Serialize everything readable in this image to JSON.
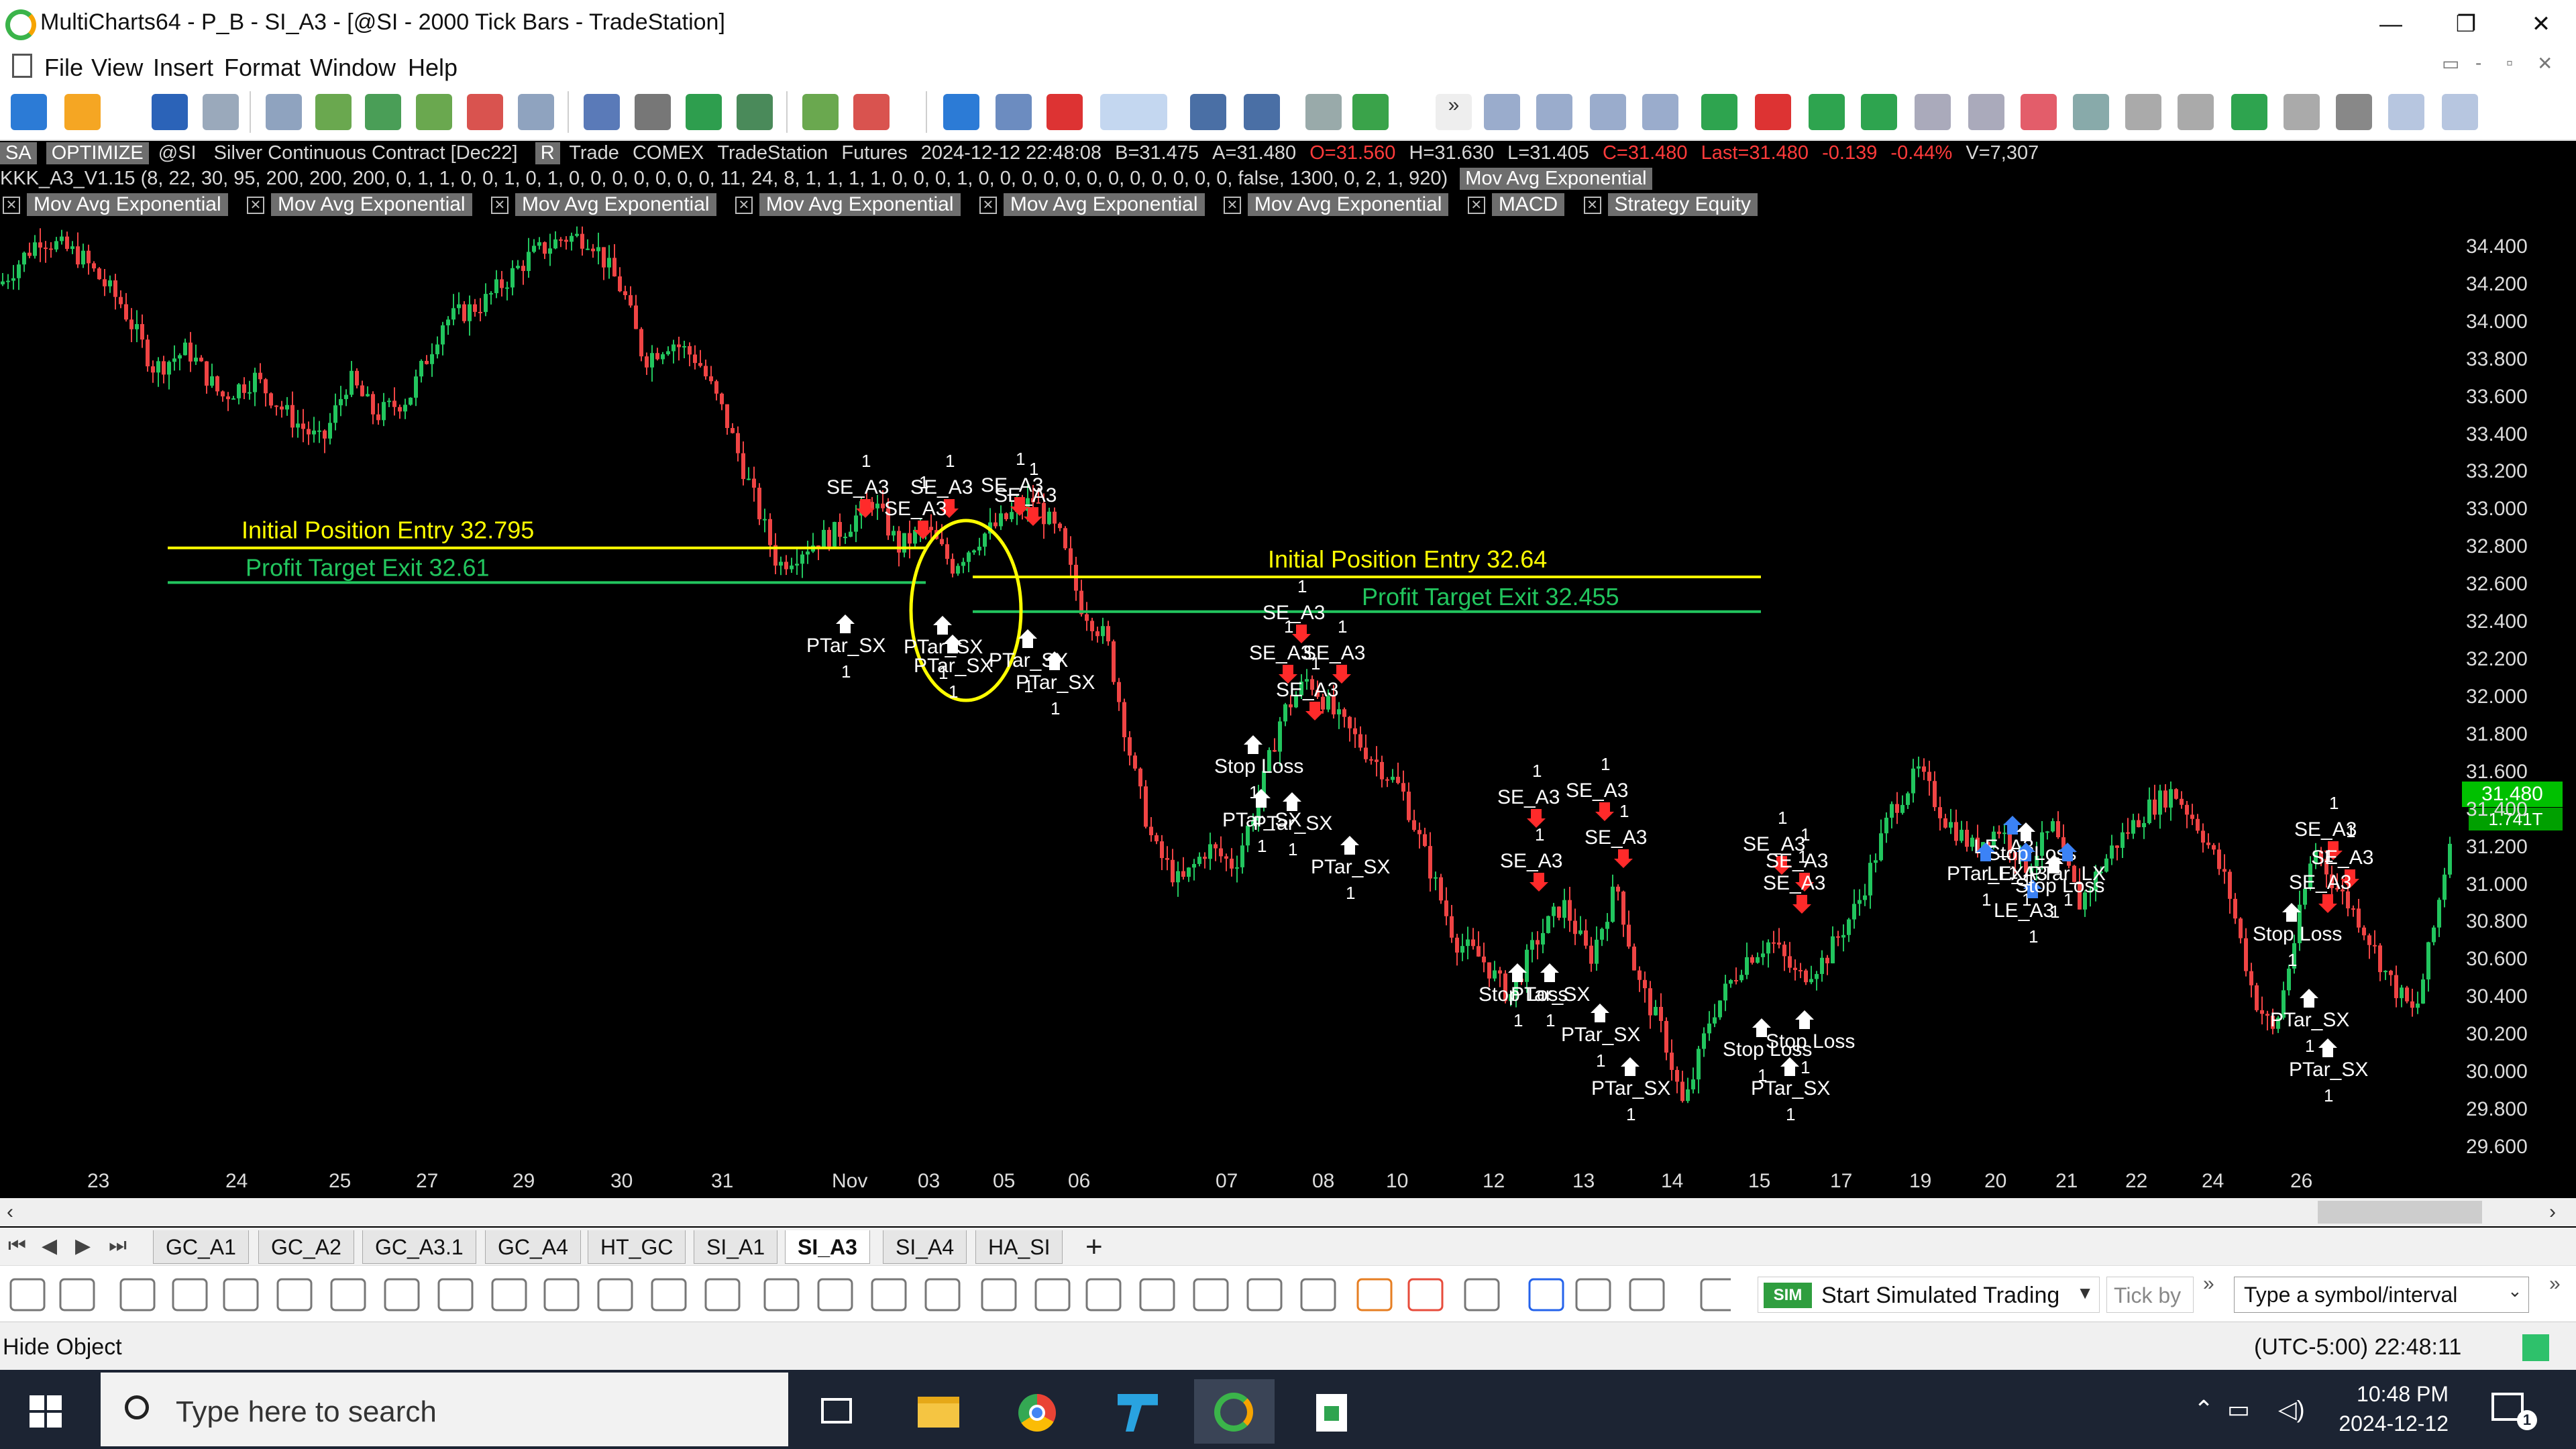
{
  "window": {
    "title": "MultiCharts64 - P_B - SI_A3 - [@SI - 2000 Tick Bars - TradeStation]",
    "minimize": "—",
    "restore": "❐",
    "close": "✕"
  },
  "menu": {
    "items": [
      "File",
      "View",
      "Insert",
      "Format",
      "Window",
      "Help"
    ],
    "right_controls": [
      "▭",
      "-",
      "▫",
      "✕"
    ]
  },
  "chart_header": {
    "mode_chip": "SA",
    "optimize_chip": "OPTIMIZE",
    "symbol": "@SI",
    "description": "Silver Continuous Contract [Dec22]",
    "r_chip": "R",
    "trade": "Trade",
    "exchange": "COMEX",
    "data_source": "TradeStation",
    "category": "Futures",
    "datetime": "2024-12-12  22:48:08",
    "bid": "B=31.475",
    "ask": "A=31.480",
    "open": "O=31.560",
    "high": "H=31.630",
    "low": "L=31.405",
    "close": "C=31.480",
    "last": "Last=31.480",
    "change": "-0.139",
    "change_pct": "-0.44%",
    "volume": "V=7,307",
    "strategy_params": "KKK_A3_V1.15 (8,  22,  30,  95,  200,  200,  200,  0,  1,  1,  0,  0,  1,  0,  1,  0,  0,  0,  0,  0,  0,  0,  11,  24,  8,  1,  1,  1,  1,  0,  0,  0,  1,  0,  0,  0,  0,  0,  0,  0,  0,  0,  0,  0,  0,  false,  1300,  0,  2,  1,  920)",
    "strategy_chip": "Mov Avg Exponential"
  },
  "indicators": [
    "Mov Avg Exponential",
    "Mov Avg Exponential",
    "Mov Avg Exponential",
    "Mov Avg Exponential",
    "Mov Avg Exponential",
    "Mov Avg Exponential",
    "MACD",
    "Strategy Equity"
  ],
  "chart_data": {
    "type": "candlestick",
    "ylim": [
      29.6,
      34.5
    ],
    "price_ticks": [
      "34.400",
      "34.200",
      "34.000",
      "33.800",
      "33.600",
      "33.400",
      "33.200",
      "33.000",
      "32.800",
      "32.600",
      "32.400",
      "32.200",
      "32.000",
      "31.800",
      "31.600",
      "31.400",
      "31.200",
      "31.000",
      "30.800",
      "30.600",
      "30.400",
      "30.200",
      "30.000",
      "29.800",
      "29.600"
    ],
    "time_ticks": [
      "23",
      "24",
      "25",
      "27",
      "29",
      "30",
      "31",
      "Nov",
      "03",
      "05",
      "06",
      "07",
      "08",
      "10",
      "12",
      "13",
      "14",
      "15",
      "17",
      "19",
      "20",
      "21",
      "22",
      "24",
      "26"
    ],
    "last_price": "31.480",
    "last_volume": "1.741T",
    "lines": [
      {
        "label": "Initial Position Entry 32.795",
        "price": 32.795,
        "color": "#ffff00"
      },
      {
        "label": "Profit Target Exit 32.61",
        "price": 32.61,
        "color": "#22c55e"
      },
      {
        "label": "Initial Position Entry 32.64",
        "price": 32.64,
        "color": "#ffff00"
      },
      {
        "label": "Profit Target Exit 32.455",
        "price": 32.455,
        "color": "#22c55e"
      }
    ],
    "trade_labels": [
      "SE_A3",
      "PTar_SX",
      "Stop Loss",
      "LE_A3",
      "PTar_LX",
      "1"
    ],
    "colors": {
      "up": "#22c55e",
      "down": "#ef4444",
      "entry": "#ffff00",
      "target": "#22c55e"
    }
  },
  "tabs": [
    "GC_A1",
    "GC_A2",
    "GC_A3.1",
    "GC_A4",
    "HT_GC",
    "SI_A1",
    "SI_A3",
    "SI_A4",
    "HA_SI"
  ],
  "active_tab": "SI_A3",
  "tab_add": "+",
  "drawing_bar": {
    "sim_badge": "SIM",
    "sim_label": "Start Simulated Trading",
    "tick_by": "Tick by",
    "symbol_placeholder": "Type a symbol/interval"
  },
  "status": {
    "left": "Hide Object",
    "right": "(UTC-5:00) 22:48:11"
  },
  "taskbar": {
    "search_placeholder": "Type here to search",
    "time": "10:48 PM",
    "date": "2024-12-12",
    "notification_count": "1"
  }
}
